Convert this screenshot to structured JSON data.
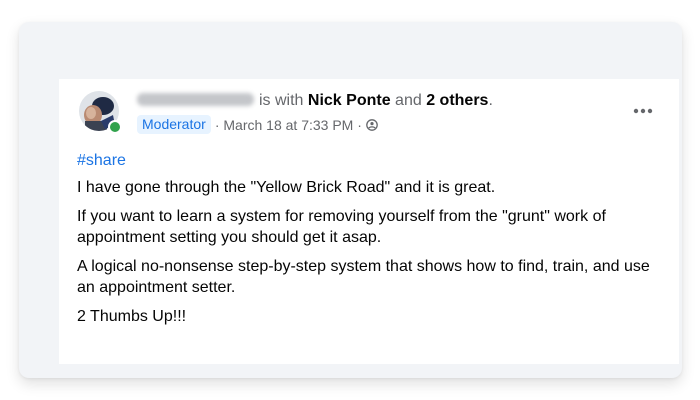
{
  "post": {
    "author": {
      "name_redacted": true,
      "online_status_color": "#31a24c"
    },
    "with_text": "is with",
    "tagged_person": "Nick Ponte",
    "and_text": "and",
    "others_text": "2 others",
    "period": ".",
    "role_badge": "Moderator",
    "separator": "·",
    "timestamp": "March 18 at 7:33 PM",
    "audience_icon": "members-icon",
    "more_options_icon": "more-options-icon",
    "hashtag": "#share",
    "paragraphs": [
      "I have gone through the \"Yellow Brick Road\" and it is great.",
      "If you want to learn a system for removing yourself from the \"grunt\" work of appointment setting you should get it asap.",
      "A logical no-nonsense step-by-step system that shows how to find, train, and use an appointment setter.",
      "2 Thumbs Up!!!"
    ]
  },
  "colors": {
    "link": "#1b74e4",
    "badge_bg": "#e7f3ff",
    "text": "#050505",
    "muted": "#65676b",
    "card_outer_bg": "#f2f4f7"
  }
}
